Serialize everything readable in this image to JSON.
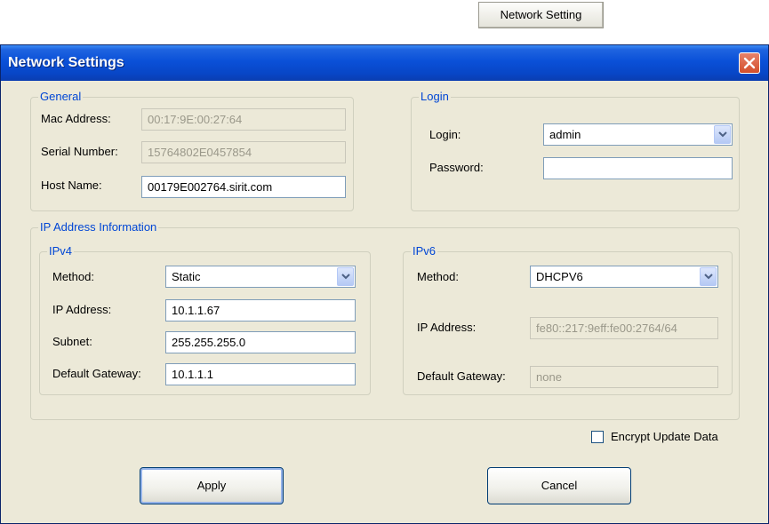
{
  "external": {
    "button_label": "Network Setting"
  },
  "window": {
    "title": "Network Settings"
  },
  "general": {
    "label": "General",
    "mac_label": "Mac Address:",
    "mac_value": "00:17:9E:00:27:64",
    "serial_label": "Serial Number:",
    "serial_value": "15764802E0457854",
    "host_label": "Host Name:",
    "host_value": "00179E002764.sirit.com"
  },
  "login": {
    "label": "Login",
    "login_label": "Login:",
    "login_value": "admin",
    "password_label": "Password:",
    "password_value": ""
  },
  "ipinfo": {
    "label": "IP Address Information"
  },
  "ipv4": {
    "label": "IPv4",
    "method_label": "Method:",
    "method_value": "Static",
    "ip_label": "IP Address:",
    "ip_value": "10.1.1.67",
    "subnet_label": "Subnet:",
    "subnet_value": "255.255.255.0",
    "gateway_label": "Default Gateway:",
    "gateway_value": "10.1.1.1"
  },
  "ipv6": {
    "label": "IPv6",
    "method_label": "Method:",
    "method_value": "DHCPV6",
    "ip_label": "IP Address:",
    "ip_value": "fe80::217:9eff:fe00:2764/64",
    "gateway_label": "Default Gateway:",
    "gateway_value": "none"
  },
  "encrypt": {
    "label": "Encrypt Update Data",
    "checked": false
  },
  "buttons": {
    "apply": "Apply",
    "cancel": "Cancel"
  }
}
